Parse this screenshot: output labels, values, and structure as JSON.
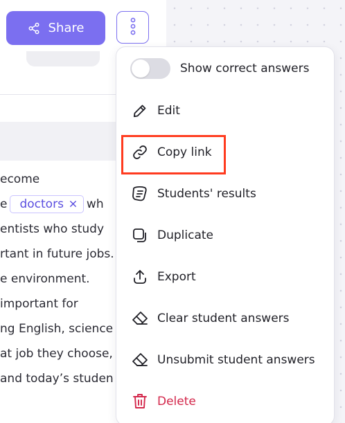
{
  "toolbar": {
    "share_label": "Share"
  },
  "content": {
    "lines": [
      "ecome",
      "e",
      "entists who study",
      "rtant in future jobs.",
      "e environment.",
      " important for",
      "ng English, science",
      "at job they choose,",
      " and today’s studen"
    ],
    "line2_suffix": "wh",
    "chip": "doctors"
  },
  "menu": {
    "show_correct_answers": "Show correct answers",
    "edit": "Edit",
    "copy_link": "Copy link",
    "students_results": "Students' results",
    "duplicate": "Duplicate",
    "export": "Export",
    "clear_student_answers": "Clear student answers",
    "unsubmit_student_answers": "Unsubmit student answers",
    "delete": "Delete"
  },
  "colors": {
    "accent": "#7b6ff0",
    "chip_text": "#5a4ee0",
    "danger": "#d3264a",
    "highlight": "#ff3b1f"
  },
  "icons": {
    "share": "share-icon",
    "more": "vertical-dots-icon",
    "edit": "pencil-icon",
    "copy_link": "link-icon",
    "students_results": "results-icon",
    "duplicate": "duplicate-icon",
    "export": "export-icon",
    "clear": "eraser-icon",
    "unsubmit": "eraser-icon",
    "delete": "trash-icon"
  },
  "toggle_state": {
    "show_correct_answers": false
  }
}
